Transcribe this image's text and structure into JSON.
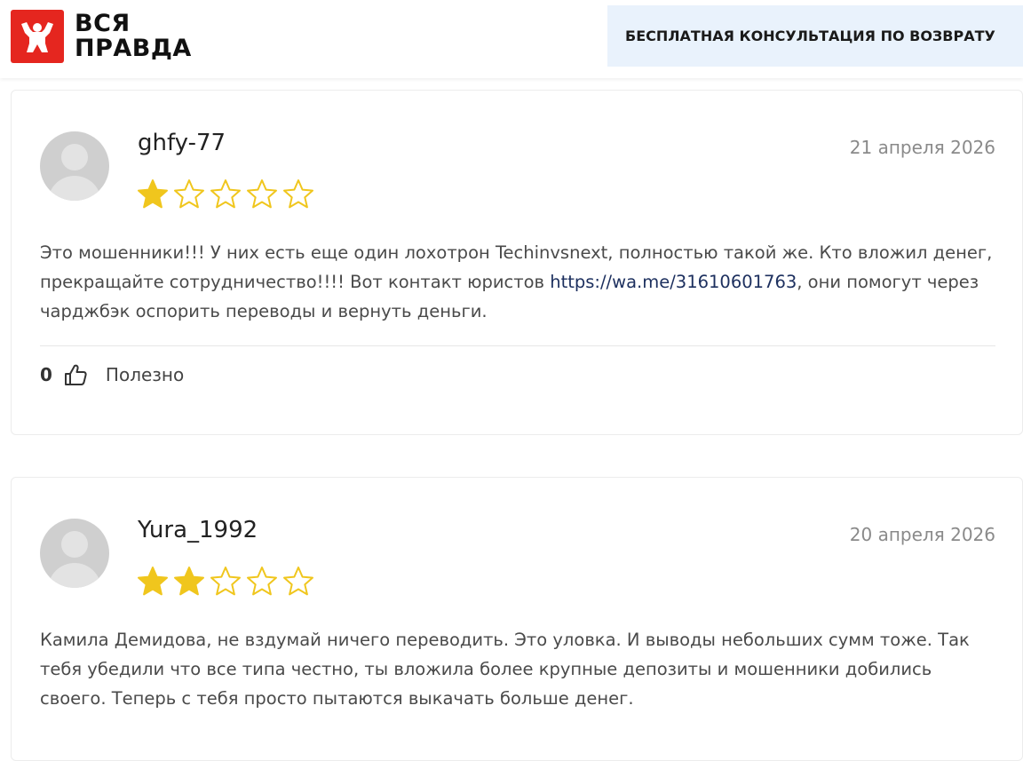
{
  "site": {
    "logo_line1": "ВСЯ",
    "logo_line2": "ПРАВДА",
    "brand_color": "#e5261f",
    "consult_label": "БЕСПЛАТНАЯ КОНСУЛЬТАЦИЯ ПО ВОЗВРАТУ"
  },
  "star_colors": {
    "filled": "#f0c61d",
    "empty_outline": "#f0c61d"
  },
  "reviews": [
    {
      "author": "ghfy-77",
      "date": "21 апреля 2026",
      "rating": 1,
      "max_rating": 5,
      "text_before_link": "Это мошенники!!! У них есть еще один лохотрон Techinvsnext, полностью такой же. Кто вложил денег, прекращайте сотрудничество!!!! Вот контакт юристов ",
      "link_text": "https://wa.me/31610601763",
      "text_after_link": ", они помогут через чарджбэк оспорить переводы и вернуть деньги.",
      "helpful_count": "0",
      "helpful_label": "Полезно"
    },
    {
      "author": "Yura_1992",
      "date": "20 апреля 2026",
      "rating": 2,
      "max_rating": 5,
      "text": "Камила Демидова, не вздумай ничего переводить. Это уловка. И выводы небольших сумм тоже. Так тебя убедили что все типа честно, ты вложила более крупные депозиты и мошенники добились своего. Теперь с тебя просто пытаются выкачать больше денег."
    }
  ]
}
